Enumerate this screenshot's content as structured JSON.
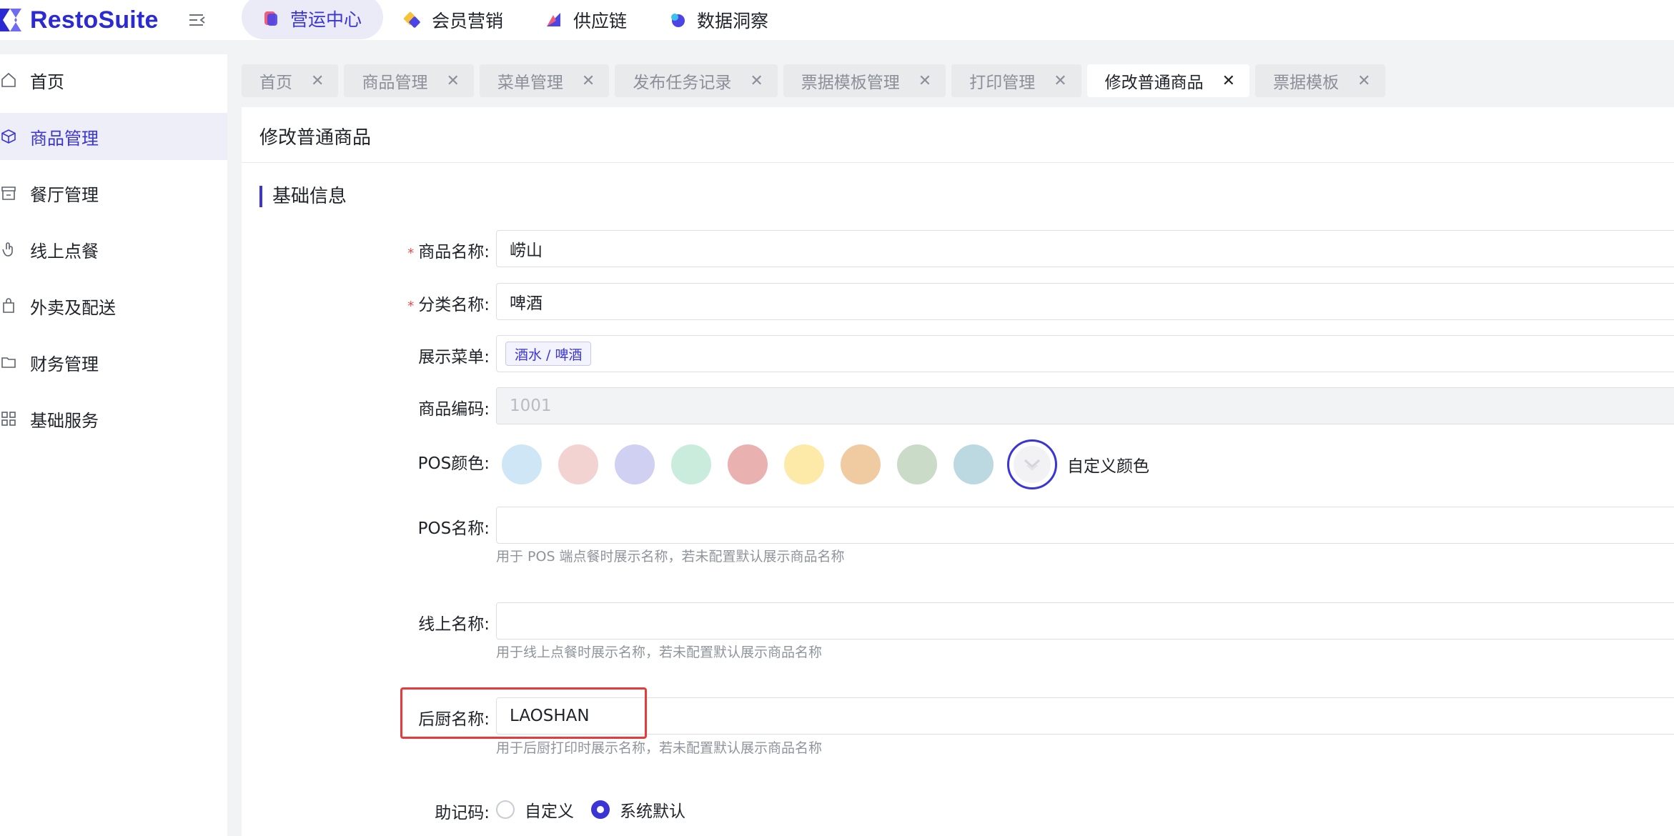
{
  "app": {
    "brand": "RestoSuite",
    "brand_color": "#2c2bd3",
    "accent_color": "#3a35d4"
  },
  "topnav": [
    {
      "label": "营运中心",
      "icon": "ops-icon",
      "active": true
    },
    {
      "label": "会员营销",
      "icon": "member-icon",
      "active": false
    },
    {
      "label": "供应链",
      "icon": "supply-icon",
      "active": false
    },
    {
      "label": "数据洞察",
      "icon": "insight-icon",
      "active": false
    }
  ],
  "sidebar": {
    "items": [
      {
        "label": "首页",
        "icon": "home-icon"
      },
      {
        "label": "商品管理",
        "icon": "cube-icon",
        "active": true
      },
      {
        "label": "餐厅管理",
        "icon": "store-icon"
      },
      {
        "label": "线上点餐",
        "icon": "touch-icon"
      },
      {
        "label": "外卖及配送",
        "icon": "bag-icon"
      },
      {
        "label": "财务管理",
        "icon": "folder-icon"
      },
      {
        "label": "基础服务",
        "icon": "grid-icon"
      }
    ]
  },
  "page_tabs": [
    {
      "label": "首页"
    },
    {
      "label": "商品管理"
    },
    {
      "label": "菜单管理"
    },
    {
      "label": "发布任务记录"
    },
    {
      "label": "票据模板管理"
    },
    {
      "label": "打印管理"
    },
    {
      "label": "修改普通商品",
      "active": true
    },
    {
      "label": "票据模板"
    }
  ],
  "page": {
    "title": "修改普通商品",
    "section": "基础信息"
  },
  "form": {
    "product_name": {
      "label": "商品名称:",
      "value": "崂山",
      "required": true
    },
    "category_name": {
      "label": "分类名称:",
      "value": "啤酒",
      "required": true
    },
    "display_menu": {
      "label": "展示菜单:",
      "tag": "酒水 / 啤酒"
    },
    "product_code": {
      "label": "商品编码:",
      "value": "1001"
    },
    "pos_color": {
      "label": "POS颜色:",
      "swatches": [
        "#cfe6f7",
        "#f3d3d1",
        "#cfd0f2",
        "#c9ecdc",
        "#e9b1b0",
        "#fdeaa8",
        "#f0cba2",
        "#cadbc8",
        "#bcd9e2"
      ],
      "custom_label": "自定义颜色",
      "selected": "custom"
    },
    "pos_name": {
      "label": "POS名称:",
      "value": "",
      "hint": "用于 POS 端点餐时展示名称，若未配置默认展示商品名称"
    },
    "online_name": {
      "label": "线上名称:",
      "value": "",
      "hint": "用于线上点餐时展示名称，若未配置默认展示商品名称"
    },
    "kitchen_name": {
      "label": "后厨名称:",
      "value": "LAOSHAN",
      "hint": "用于后厨打印时展示名称，若未配置默认展示商品名称"
    },
    "mnemonic": {
      "label": "助记码:",
      "options": [
        {
          "label": "自定义",
          "checked": false
        },
        {
          "label": "系统默认",
          "checked": true
        }
      ]
    }
  }
}
